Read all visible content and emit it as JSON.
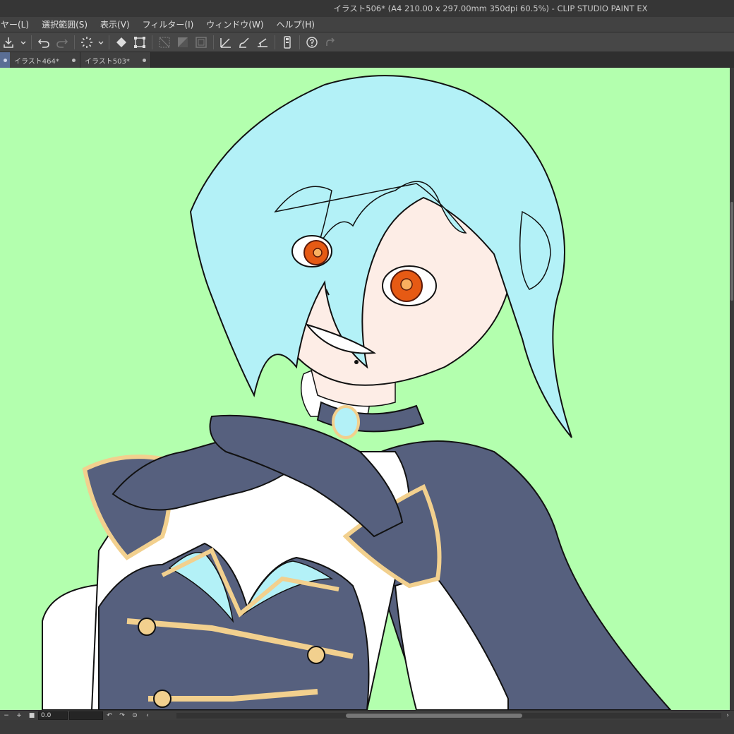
{
  "window": {
    "title": "イラスト506* (A4 210.00 x 297.00mm 350dpi 60.5%)  - CLIP STUDIO PAINT EX"
  },
  "menu": {
    "items": [
      {
        "label": "ヤー(L)"
      },
      {
        "label": "選択範囲(S)"
      },
      {
        "label": "表示(V)"
      },
      {
        "label": "フィルター(I)"
      },
      {
        "label": "ウィンドウ(W)"
      },
      {
        "label": "ヘルプ(H)"
      }
    ]
  },
  "toolbar": {
    "icons": [
      "save-icon",
      "undo-icon",
      "redo-icon",
      "loading-icon",
      "fill-icon",
      "transform-icon",
      "deselect-icon",
      "invert-selection-icon",
      "selection-border-icon",
      "ruler-icon",
      "brush-icon",
      "perspective-ruler-icon",
      "smartphone-icon",
      "help-icon",
      "redo-arrow-icon"
    ]
  },
  "tabs": [
    {
      "label": "イラスト464*"
    },
    {
      "label": "イラスト503*"
    }
  ],
  "canvas": {
    "background": "#b3ffae",
    "hair_color": "#b3f1f7",
    "skin_color": "#fdede6",
    "outfit_color": "#56607e",
    "trim_color": "#f2d08e",
    "eye_color": "#e65a14"
  },
  "status": {
    "rotation_value": "0.0"
  }
}
